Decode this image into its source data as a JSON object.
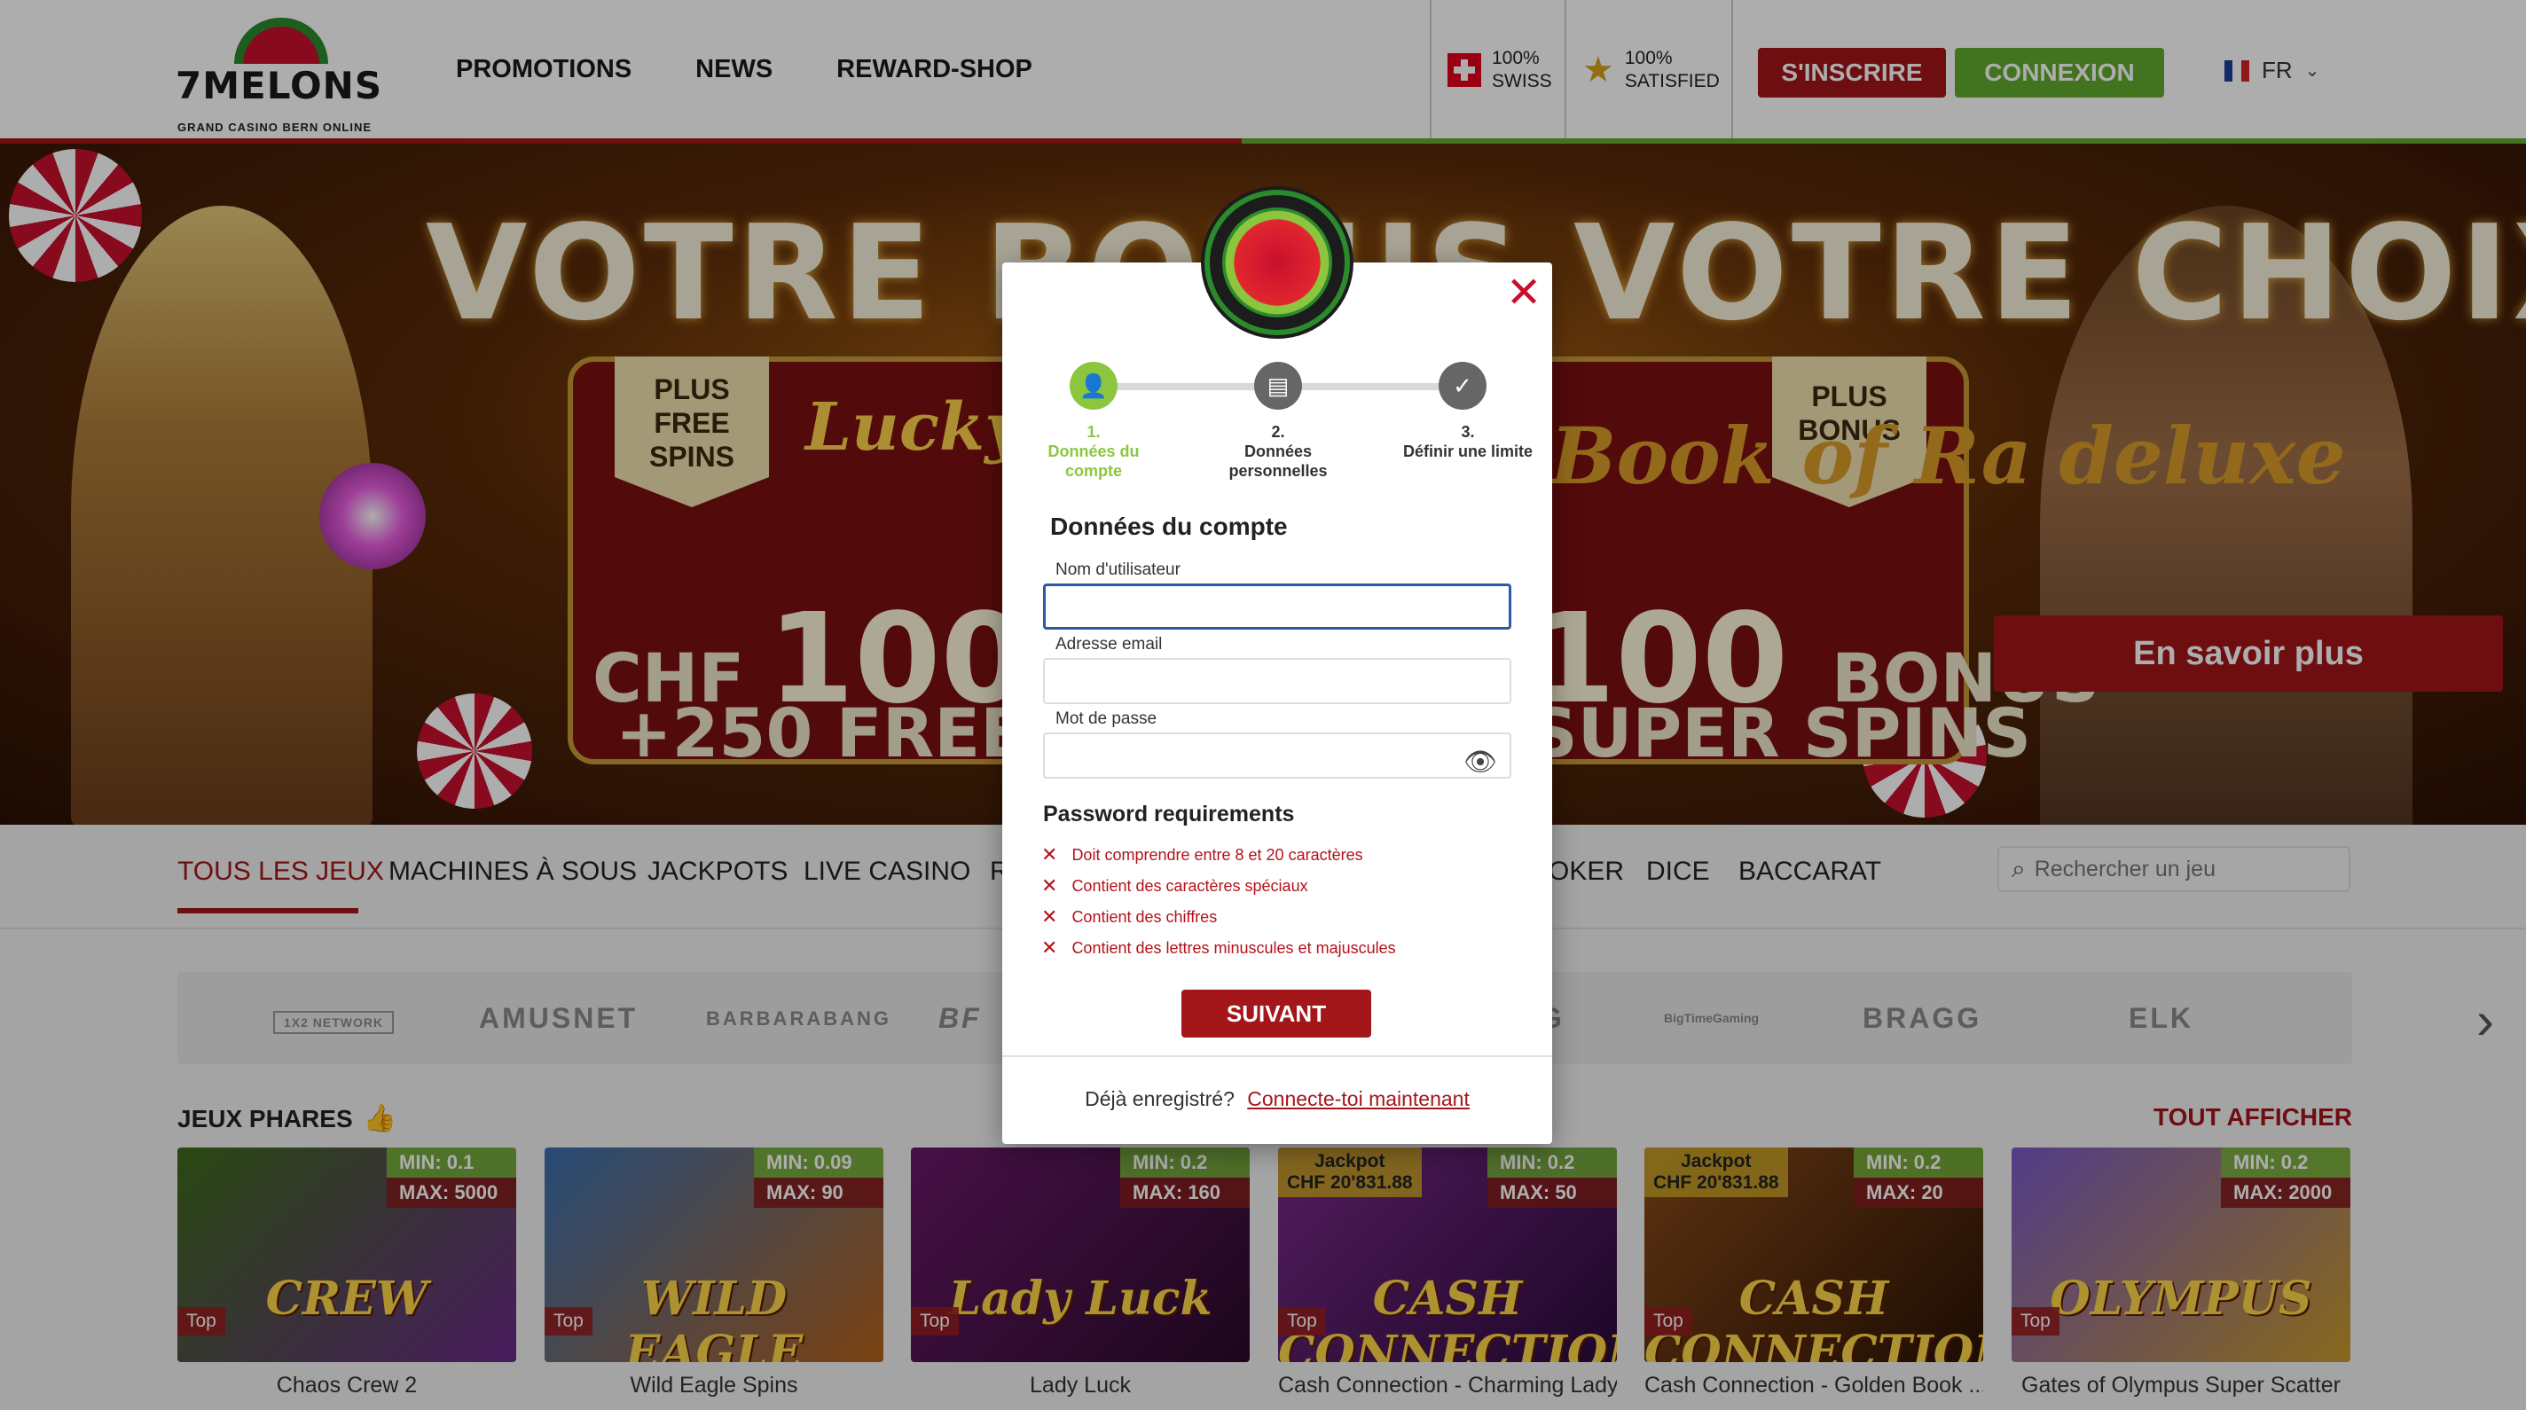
{
  "header": {
    "logo_brand": "7MELONS",
    "logo_subtitle": "GRAND CASINO BERN ONLINE",
    "nav": [
      "PROMOTIONS",
      "NEWS",
      "REWARD-SHOP"
    ],
    "trust_swiss": [
      "100%",
      "SWISS"
    ],
    "trust_satisfied": [
      "100%",
      "SATISFIED"
    ],
    "register_label": "S'INSCRIRE",
    "login_label": "CONNEXION",
    "language": "FR"
  },
  "hero": {
    "title": "VOTRE BONUS VOTRE CHOIX",
    "left_ribbon": [
      "PLUS",
      "FREE",
      "SPINS"
    ],
    "right_ribbon": [
      "PLUS",
      "BONUS"
    ],
    "left_slot": "Lucky Lady's Charm",
    "right_slot": "Book of Ra deluxe",
    "left_offer_line1_prefix": "CHF",
    "left_offer_line1_amount": "100",
    "left_offer_line2": "+250 FREE SPINS",
    "right_offer_line1_amount": "100",
    "right_offer_line1_suffix": "BONUS",
    "right_offer_line2": "SUPER SPINS",
    "cta_label": "En savoir plus"
  },
  "categories": {
    "items": [
      "TOUS LES JEUX",
      "MACHINES À SOUS",
      "JACKPOTS",
      "LIVE CASINO",
      "R",
      "OKER",
      "DICE",
      "BACCARAT"
    ],
    "active_index": 0,
    "search_placeholder": "Rechercher un jeu"
  },
  "providers": [
    "1X2 NETWORK",
    "AMUSNET",
    "BARBARABANG",
    "BF",
    "G",
    "BigTimeGaming",
    "BRAGG",
    "ELK"
  ],
  "featured": {
    "title": "JEUX PHARES",
    "see_all": "TOUT AFFICHER",
    "games": [
      {
        "name": "Chaos Crew 2",
        "min": "MIN: 0.1",
        "max": "MAX: 5000",
        "jackpot": null,
        "badge": "Top",
        "art_text": "CREW",
        "color_a": "#3d6b1a",
        "color_b": "#6b2a8a"
      },
      {
        "name": "Wild Eagle Spins",
        "min": "MIN: 0.09",
        "max": "MAX: 90",
        "jackpot": null,
        "badge": "Top",
        "art_text": "WILD EAGLE",
        "color_a": "#3a6fb0",
        "color_b": "#b5621a"
      },
      {
        "name": "Lady Luck",
        "min": "MIN: 0.2",
        "max": "MAX: 160",
        "jackpot": null,
        "badge": "Top",
        "art_text": "Lady Luck",
        "color_a": "#6a1a6a",
        "color_b": "#2a0a2a"
      },
      {
        "name": "Cash Connection - Charming Lady",
        "min": "MIN: 0.2",
        "max": "MAX: 50",
        "jackpot": [
          "Jackpot",
          "CHF 20'831.88"
        ],
        "badge": "Top",
        "art_text": "CASH CONNECTION",
        "color_a": "#7a2a8a",
        "color_b": "#2a0a3a"
      },
      {
        "name": "Cash Connection - Golden Book ...",
        "min": "MIN: 0.2",
        "max": "MAX: 20",
        "jackpot": [
          "Jackpot",
          "CHF 20'831.88"
        ],
        "badge": "Top",
        "art_text": "CASH CONNECTION",
        "color_a": "#8a4a1a",
        "color_b": "#2a1204"
      },
      {
        "name": "Gates of Olympus Super Scatter",
        "min": "MIN: 0.2",
        "max": "MAX: 2000",
        "jackpot": null,
        "badge": "Top",
        "art_text": "OLYMPUS",
        "color_a": "#7a5ac8",
        "color_b": "#c89a2a"
      }
    ]
  },
  "modal": {
    "steps": [
      {
        "number": "1.",
        "label": "Données du compte",
        "active": true
      },
      {
        "number": "2.",
        "label": "Données personnelles",
        "active": false
      },
      {
        "number": "3.",
        "label": "Définir une limite",
        "active": false
      }
    ],
    "form_title": "Données du compte",
    "username_label": "Nom d'utilisateur",
    "username_value": "",
    "email_label": "Adresse email",
    "email_value": "",
    "password_label": "Mot de passe",
    "password_value": "",
    "requirements_title": "Password requirements",
    "requirements": [
      "Doit comprendre entre 8 et 20 caractères",
      "Contient des caractères spéciaux",
      "Contient des chiffres",
      "Contient des lettres minuscules et majuscules"
    ],
    "next_label": "SUIVANT",
    "footer_text": "Déjà enregistré?",
    "footer_link": "Connecte-toi maintenant"
  },
  "colors": {
    "brand_red": "#a3161a",
    "brand_green": "#62ab2e",
    "step_active": "#8cc63f",
    "input_focus": "#2c5aa0"
  }
}
